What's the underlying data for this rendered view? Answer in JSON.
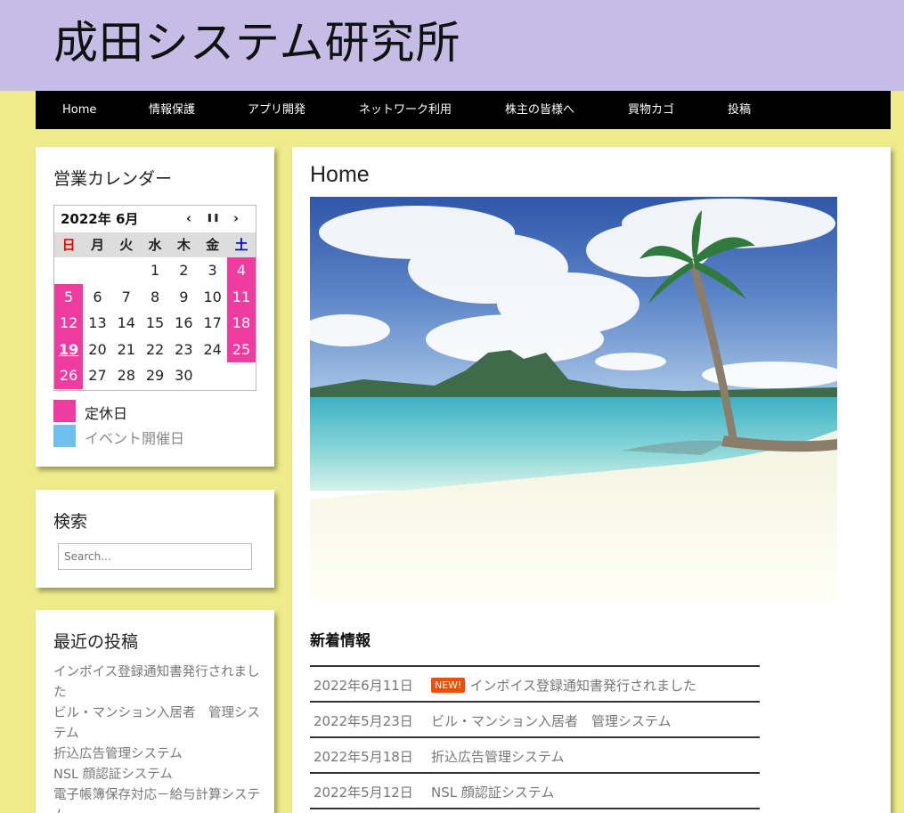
{
  "header": {
    "site_title": "成田システム研究所"
  },
  "nav": [
    "Home",
    "情報保護",
    "アプリ開発",
    "ネットワーク利用",
    "株主の皆様へ",
    "買物カゴ",
    "投稿"
  ],
  "calendar_widget": {
    "title": "営業カレンダー",
    "month_label": "2022年 6月",
    "prev_icon": "‹",
    "pause_icon": "❚❚",
    "next_icon": "›",
    "weekdays": [
      "日",
      "月",
      "火",
      "水",
      "木",
      "金",
      "土"
    ],
    "days": [
      "",
      "",
      "",
      "1",
      "2",
      "3",
      "4",
      "5",
      "6",
      "7",
      "8",
      "9",
      "10",
      "11",
      "12",
      "13",
      "14",
      "15",
      "16",
      "17",
      "18",
      "19",
      "20",
      "21",
      "22",
      "23",
      "24",
      "25",
      "26",
      "27",
      "28",
      "29",
      "30",
      "",
      ""
    ],
    "closed_days": [
      "4",
      "5",
      "11",
      "12",
      "18",
      "19",
      "25",
      "26"
    ],
    "today": "19",
    "legend": [
      {
        "label": "定休日",
        "color": "#f03ca1"
      },
      {
        "label": "イベント開催日",
        "color": "#6ec1ef"
      }
    ]
  },
  "search_widget": {
    "title": "検索",
    "placeholder": "Search..."
  },
  "recent_widget": {
    "title": "最近の投稿",
    "items": [
      "インボイス登録通知書発行されました",
      "ビル・マンション入居者　管理システム￼",
      "折込広告管理システム",
      "NSL 顔認証システム",
      "電子帳簿保存対応－給与計算システム"
    ]
  },
  "main": {
    "page_title": "Home",
    "news_heading": "新着情報",
    "new_badge": "NEW!",
    "news": [
      {
        "date": "2022年6月11日",
        "title": "インボイス登録通知書発行されました",
        "is_new": true
      },
      {
        "date": "2022年5月23日",
        "title": "ビル・マンション入居者　管理システム￼",
        "is_new": false
      },
      {
        "date": "2022年5月18日",
        "title": "折込広告管理システム",
        "is_new": false
      },
      {
        "date": "2022年5月12日",
        "title": "NSL 顔認証システム",
        "is_new": false
      }
    ]
  },
  "colors": {
    "header_bg": "#c6bde6",
    "page_bg": "#eeeb8a",
    "nav_bg": "#000000",
    "closed_day": "#f03ca1",
    "event_day": "#6ec1ef",
    "new_badge": "#f04e00"
  }
}
